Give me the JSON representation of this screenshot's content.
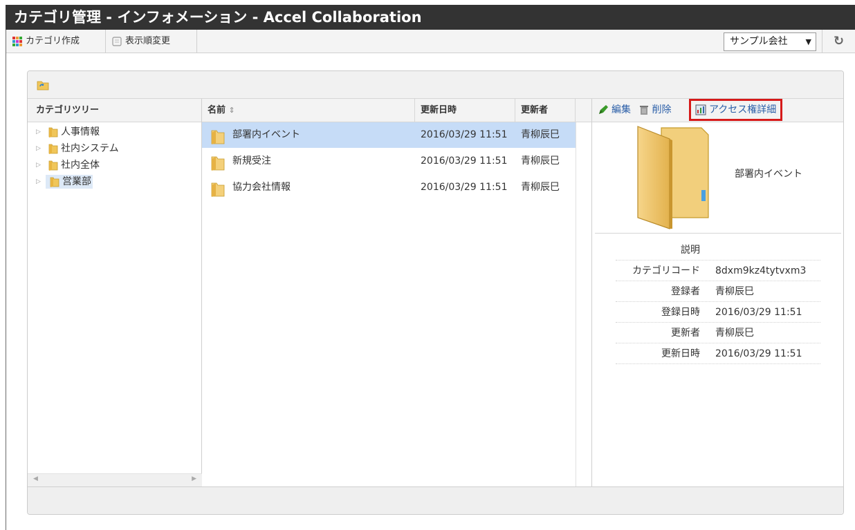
{
  "window": {
    "title": "カテゴリ管理 - インフォメーション - Accel Collaboration"
  },
  "toolbar": {
    "create_category": "カテゴリ作成",
    "change_order": "表示順変更",
    "company_select": "サンプル会社",
    "reload_icon": "reload-icon"
  },
  "tree": {
    "header": "カテゴリツリー",
    "items": [
      {
        "label": "人事情報",
        "selected": false
      },
      {
        "label": "社内システム",
        "selected": false
      },
      {
        "label": "社内全体",
        "selected": false
      },
      {
        "label": "営業部",
        "selected": true
      }
    ]
  },
  "list": {
    "headers": {
      "name": "名前",
      "sort_indicator": "⇕",
      "updated": "更新日時",
      "updater": "更新者"
    },
    "rows": [
      {
        "name": "部署内イベント",
        "updated": "2016/03/29 11:51",
        "updater": "青柳辰巳",
        "selected": true
      },
      {
        "name": "新規受注",
        "updated": "2016/03/29 11:51",
        "updater": "青柳辰巳",
        "selected": false
      },
      {
        "name": "協力会社情報",
        "updated": "2016/03/29 11:51",
        "updater": "青柳辰巳",
        "selected": false
      }
    ]
  },
  "detail": {
    "actions": {
      "edit": "編集",
      "delete": "削除",
      "access": "アクセス権詳細"
    },
    "folder_name": "部署内イベント",
    "props": [
      {
        "key": "説明",
        "value": ""
      },
      {
        "key": "カテゴリコード",
        "value": "8dxm9kz4tytvxm3"
      },
      {
        "key": "登録者",
        "value": "青柳辰巳"
      },
      {
        "key": "登録日時",
        "value": "2016/03/29 11:51"
      },
      {
        "key": "更新者",
        "value": "青柳辰巳"
      },
      {
        "key": "更新日時",
        "value": "2016/03/29 11:51"
      }
    ]
  },
  "colors": {
    "titlebar": "#333333",
    "selection": "#c6dcf7",
    "highlight_box": "#d61a1a",
    "link": "#2b5fa8"
  }
}
